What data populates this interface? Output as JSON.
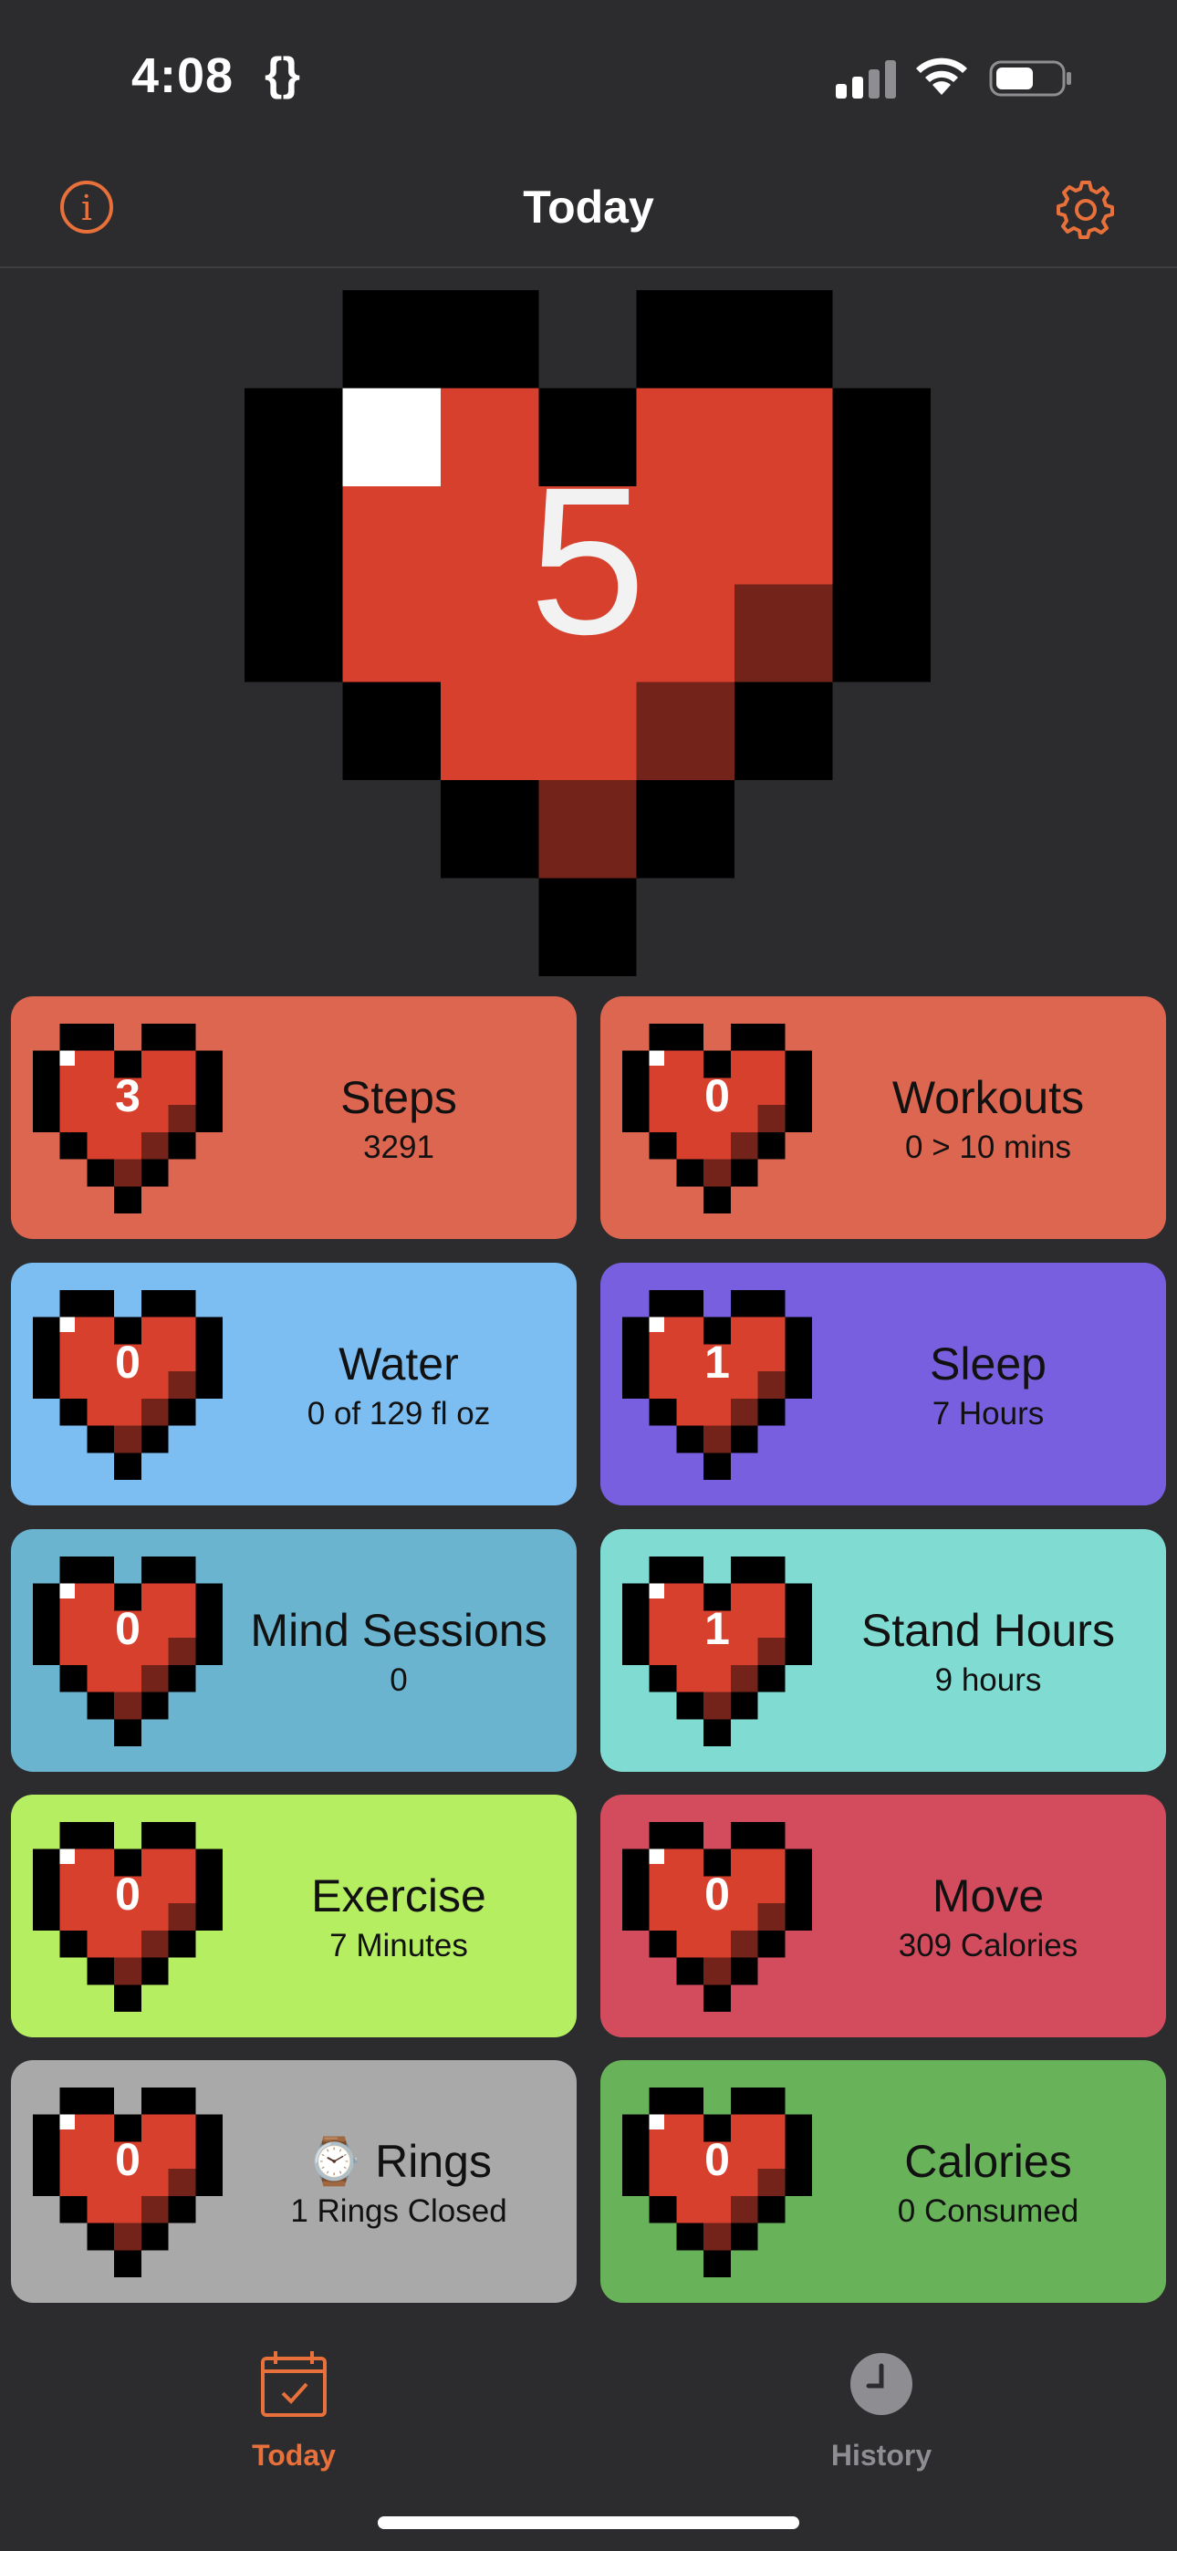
{
  "status_bar": {
    "time": "4:08",
    "braces": "{}",
    "battery_icon": "battery-icon",
    "wifi_icon": "wifi-icon",
    "signal_icon": "signal-icon"
  },
  "nav": {
    "title": "Today",
    "info_glyph": "i",
    "info_icon": "info-icon",
    "settings_icon": "gear-icon"
  },
  "hero": {
    "score": "5",
    "icon": "pixel-heart-icon"
  },
  "colors": {
    "accent": "#e8703a",
    "background": "#2c2c2e",
    "heart_red": "#d8402e",
    "heart_dark": "#73231a",
    "heart_outline": "#000000"
  },
  "cards": [
    {
      "title": "Steps",
      "subtitle": "3291",
      "score": "3",
      "color": "#dc6650"
    },
    {
      "title": "Workouts",
      "subtitle": "0 > 10 mins",
      "score": "0",
      "color": "#dc6650"
    },
    {
      "title": "Water",
      "subtitle": "0 of 129 fl oz",
      "score": "0",
      "color": "#7cbdf2"
    },
    {
      "title": "Sleep",
      "subtitle": "7 Hours",
      "score": "1",
      "color": "#785fdf"
    },
    {
      "title": "Mind Sessions",
      "subtitle": "0",
      "score": "0",
      "color": "#6bb4cf"
    },
    {
      "title": "Stand Hours",
      "subtitle": "9 hours",
      "score": "1",
      "color": "#80dcd2"
    },
    {
      "title": "Exercise",
      "subtitle": "7 Minutes",
      "score": "0",
      "color": "#b6ee62"
    },
    {
      "title": "Move",
      "subtitle": "309 Calories",
      "score": "0",
      "color": "#d24c5e"
    },
    {
      "title": "Rings",
      "title_prefix": "⌚",
      "subtitle": "1 Rings Closed",
      "score": "0",
      "color": "#a9a9a9"
    },
    {
      "title": "Calories",
      "subtitle": "0 Consumed",
      "score": "0",
      "color": "#68b25a"
    }
  ],
  "tabs": [
    {
      "label": "Today",
      "icon": "calendar-check-icon",
      "active": true
    },
    {
      "label": "History",
      "icon": "clock-icon",
      "active": false
    }
  ]
}
